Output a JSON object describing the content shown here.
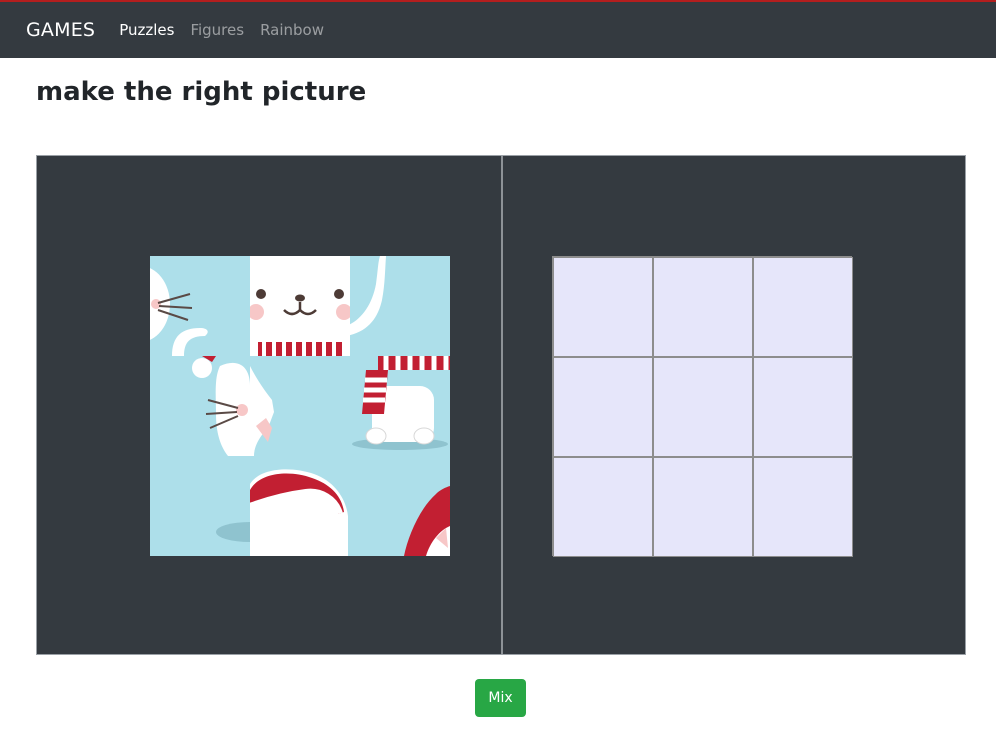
{
  "navbar": {
    "brand": "GAMES",
    "links": [
      {
        "label": "Puzzles",
        "active": true
      },
      {
        "label": "Figures",
        "active": false
      },
      {
        "label": "Rainbow",
        "active": false
      }
    ]
  },
  "page": {
    "title": "make the right picture"
  },
  "puzzle": {
    "grid": "3x3",
    "pieces": [
      "cat-whiskers-tail-piece",
      "cat-face-scarf-piece",
      "cat-tail-sky-piece",
      "cat-hat-pompom-whiskers-piece",
      "cat-ear-sky-piece",
      "striped-scarf-body-piece",
      "sky-piece",
      "santa-hat-piece",
      "red-hat-corner-piece"
    ]
  },
  "target": {
    "rows": 3,
    "cols": 3
  },
  "controls": {
    "mix_label": "Mix"
  },
  "colors": {
    "navbar": "#343a40",
    "board": "#343a40",
    "sky": "#addfea",
    "slot": "#e6e6fa",
    "hat_red": "#c21f32",
    "button": "#28a745"
  }
}
